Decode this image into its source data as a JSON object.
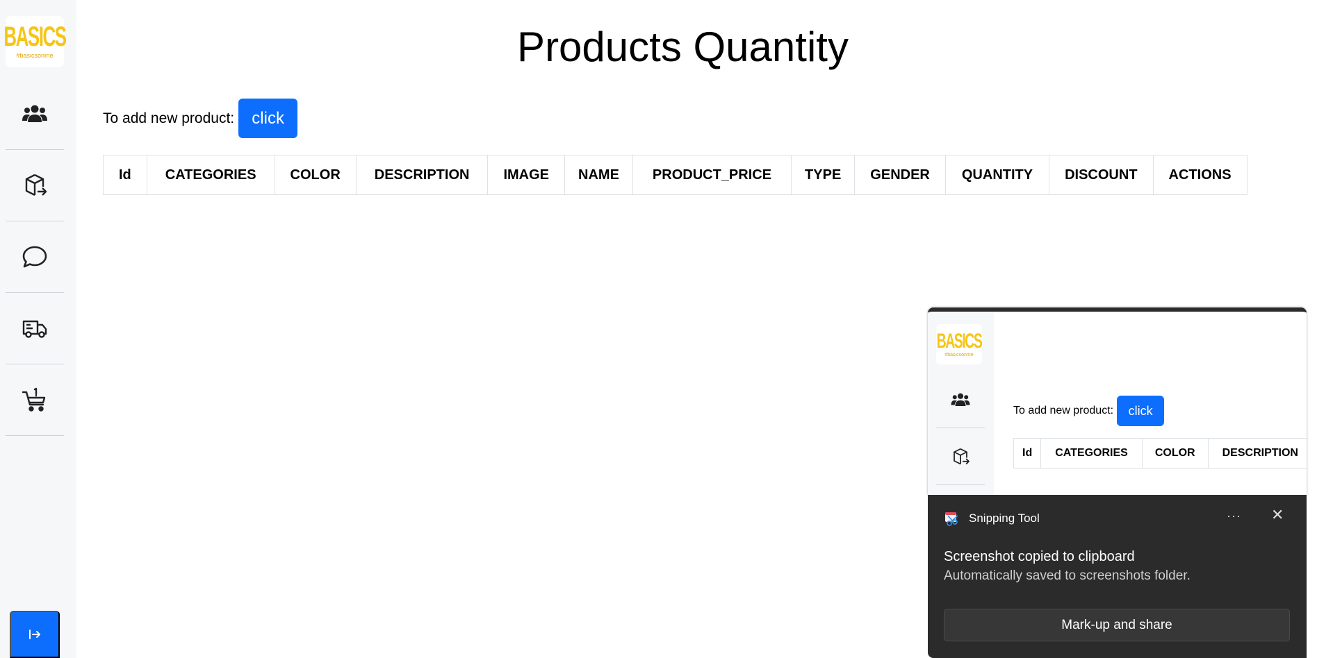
{
  "brand": {
    "wordmark": "BASICS",
    "tagline": "#basicsonme",
    "color": "#f5c518"
  },
  "sidebar": {
    "items": [
      {
        "icon": "users-icon",
        "label": "Users"
      },
      {
        "icon": "box-export-icon",
        "label": "Products"
      },
      {
        "icon": "chat-icon",
        "label": "Messages"
      },
      {
        "icon": "truck-icon",
        "label": "Delivery"
      },
      {
        "icon": "cart-icon",
        "label": "Orders"
      }
    ],
    "logout_icon": "logout-icon"
  },
  "main": {
    "title": "Products Quantity",
    "add_prompt": "To add new product:",
    "add_button": "click",
    "table": {
      "columns": [
        "Id",
        "CATEGORIES",
        "COLOR",
        "DESCRIPTION",
        "IMAGE",
        "NAME",
        "PRODUCT_PRICE",
        "TYPE",
        "GENDER",
        "QUANTITY",
        "DISCOUNT",
        "ACTIONS"
      ],
      "rows": []
    }
  },
  "preview": {
    "add_prompt": "To add new product:",
    "add_button": "click",
    "columns": [
      "Id",
      "CATEGORIES",
      "COLOR",
      "DESCRIPTION"
    ]
  },
  "notification": {
    "app_name": "Snipping Tool",
    "more": "···",
    "close": "✕",
    "title": "Screenshot copied to clipboard",
    "subtitle": "Automatically saved to screenshots folder.",
    "action": "Mark-up and share"
  },
  "colors": {
    "primary": "#0d6efd",
    "sidebar_bg": "#f6f7f9",
    "toast_bg": "#2b2b2b"
  }
}
